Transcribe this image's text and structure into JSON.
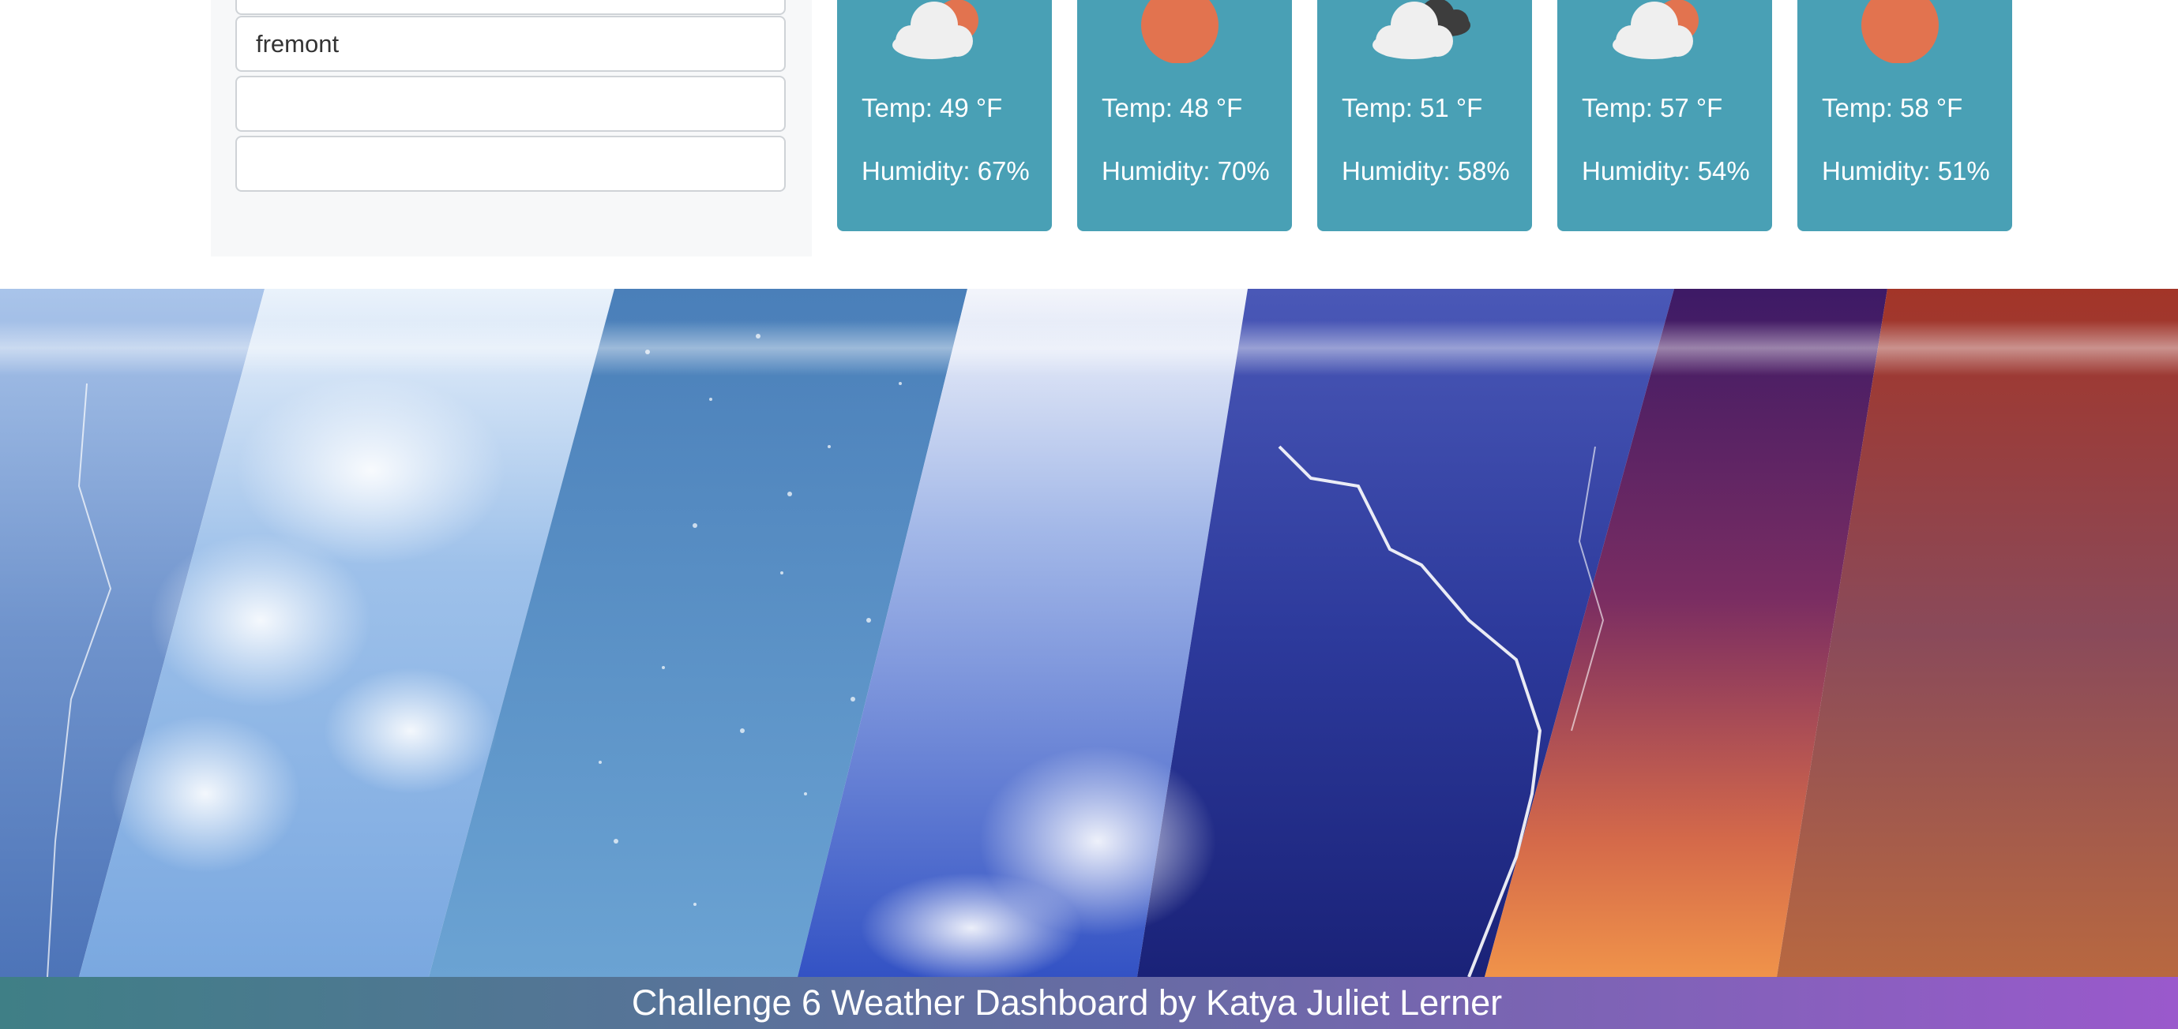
{
  "search_history": {
    "entries": [
      {
        "value": ""
      },
      {
        "value": "fremont"
      },
      {
        "value": ""
      },
      {
        "value": ""
      }
    ]
  },
  "forecast": [
    {
      "icon": "partly-cloudy-icon",
      "temp": "Temp: 49 °F",
      "humidity": "Humidity: 67%"
    },
    {
      "icon": "sun-icon",
      "temp": "Temp: 48 °F",
      "humidity": "Humidity: 70%"
    },
    {
      "icon": "cloudy-icon",
      "temp": "Temp: 51 °F",
      "humidity": "Humidity: 58%"
    },
    {
      "icon": "partly-cloudy-icon",
      "temp": "Temp: 57 °F",
      "humidity": "Humidity: 54%"
    },
    {
      "icon": "sun-icon",
      "temp": "Temp: 58 °F",
      "humidity": "Humidity: 51%"
    }
  ],
  "footer": {
    "text": "Challenge 6 Weather Dashboard by Katya Juliet Lerner"
  },
  "colors": {
    "card_background": "#49a0b5",
    "sun": "#e2734f",
    "cloud": "#efefef",
    "dark_cloud": "#3d3d3d",
    "footer_gradient_start": "#3f7f86",
    "footer_gradient_end": "#9a59cc"
  }
}
